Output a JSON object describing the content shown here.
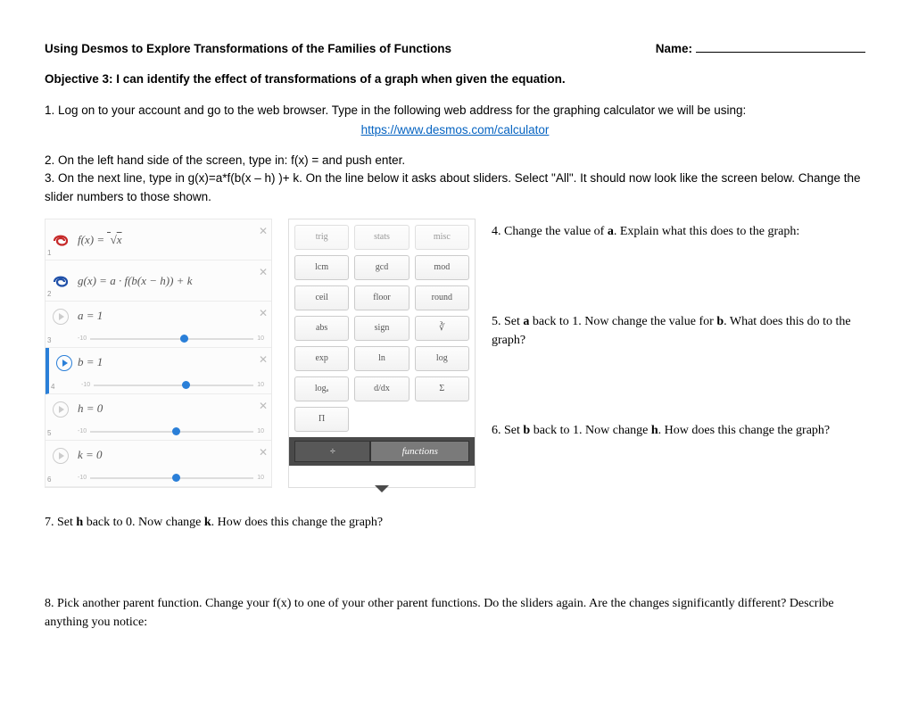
{
  "title": "Using Desmos to Explore Transformations of the Families of Functions",
  "name_label": "Name:",
  "objective": "Objective 3:  I can identify the effect of transformations of a graph when given the equation.",
  "step1": "1.  Log on to your account and go to the web browser.  Type in the following web address for the graphing calculator we will be using:",
  "link": "https://www.desmos.com/calculator",
  "step2": "2.  On the left hand side of the screen, type in:  f(x) =  and push enter.",
  "step3": "3.  On the next line, type in g(x)=a*f(b(x – h) )+ k.  On the line below it asks about sliders.  Select \"All\".  It should now look like the screen below.  Change the slider numbers to those shown.",
  "calc": {
    "expr1": "f(x) = √x",
    "expr2": "g(x) = a · f(b(x − h)) + k",
    "s_a": "a = 1",
    "s_b": "b = 1",
    "s_h": "h = 0",
    "s_k": "k = 0",
    "min": "-10",
    "max": "10"
  },
  "keypad": {
    "row1": [
      "trig",
      "stats",
      "misc"
    ],
    "row2": [
      "lcm",
      "gcd",
      "mod"
    ],
    "row3": [
      "ceil",
      "floor",
      "round"
    ],
    "row4": [
      "abs",
      "sign",
      "∛"
    ],
    "row5": [
      "exp",
      "ln",
      "log"
    ],
    "row6": [
      "logₐ",
      "d/dx",
      "Σ"
    ],
    "row7_single": "Π",
    "tab1": "÷",
    "tab2": "functions"
  },
  "q4": "4.  Change the value of a.  Explain what this does to the graph:",
  "q5": "5.  Set a back to 1.  Now change the value for b.  What does this do to the graph?",
  "q6": "6.  Set b back to 1.  Now change h.  How does this change the graph?",
  "q7": "7.  Set h back to 0.  Now change k.  How does this change the graph?",
  "q8": "8.  Pick another parent function.  Change your f(x) to one of your other parent functions.  Do the sliders again.  Are the changes significantly different?  Describe anything you notice:"
}
